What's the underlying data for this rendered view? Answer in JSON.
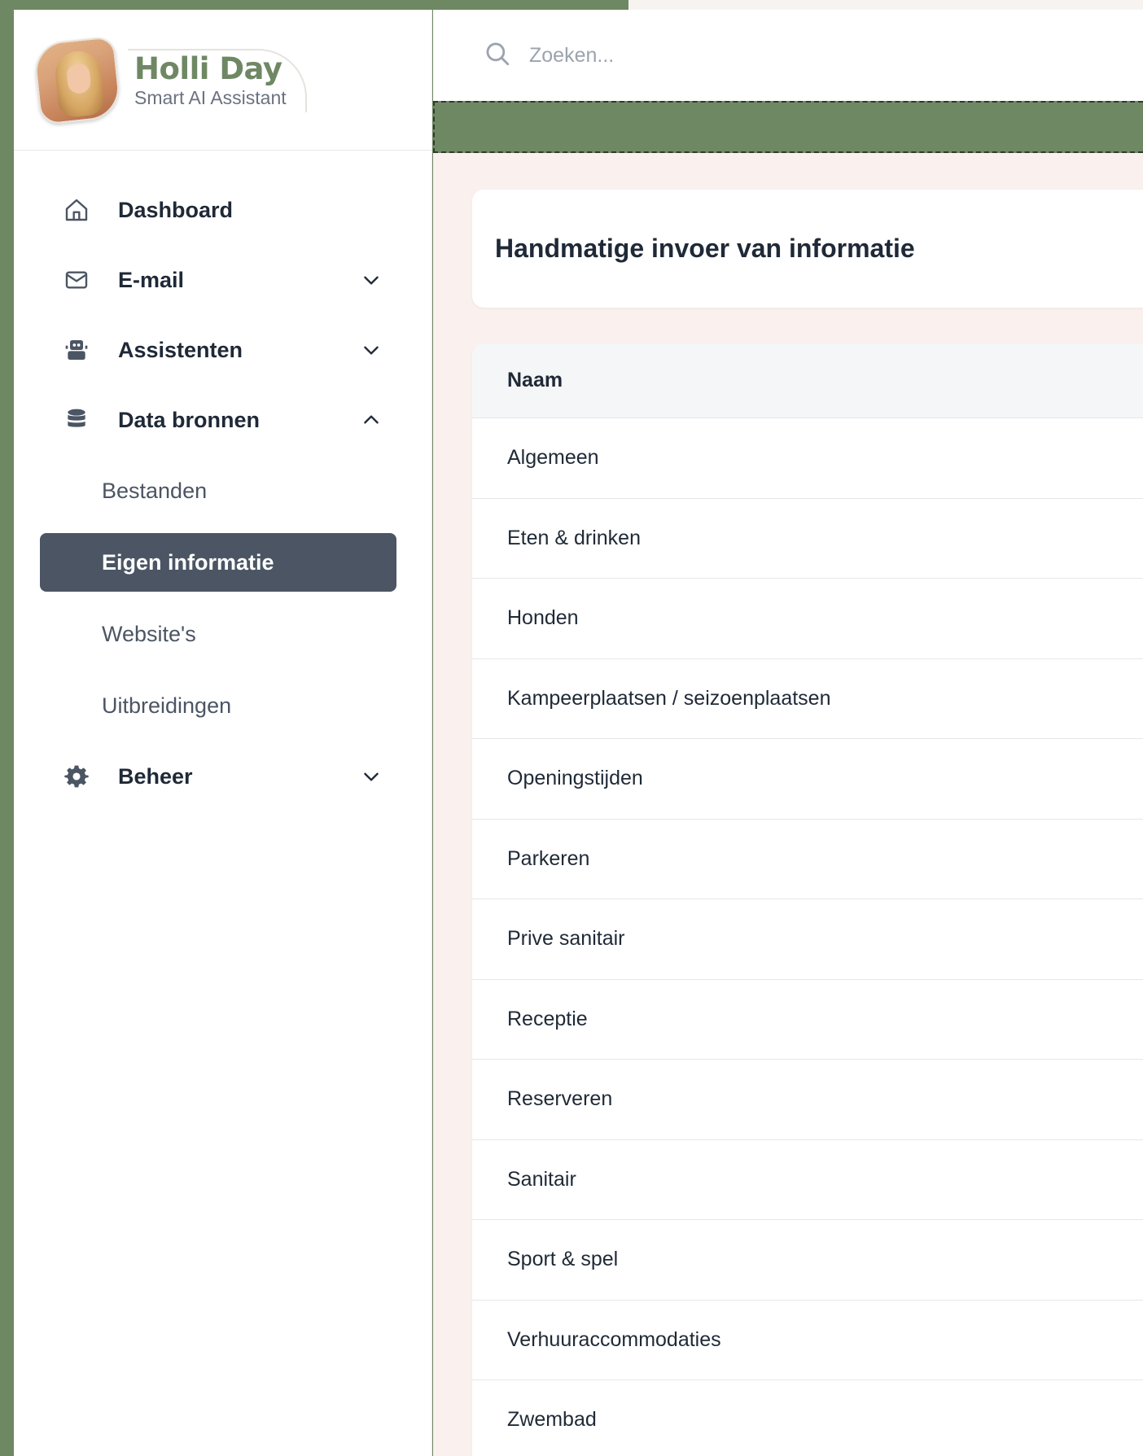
{
  "brand": {
    "name": "Holli Day",
    "subtitle": "Smart AI Assistant"
  },
  "search": {
    "placeholder": "Zoeken..."
  },
  "sidebar": {
    "items": [
      {
        "label": "Dashboard",
        "icon": "home-icon"
      },
      {
        "label": "E-mail",
        "icon": "mail-icon",
        "expanded": false
      },
      {
        "label": "Assistenten",
        "icon": "robot-icon",
        "expanded": false
      },
      {
        "label": "Data bronnen",
        "icon": "database-icon",
        "expanded": true
      },
      {
        "label": "Beheer",
        "icon": "gear-icon",
        "expanded": false
      }
    ],
    "data_sources_children": [
      {
        "label": "Bestanden",
        "active": false
      },
      {
        "label": "Eigen informatie",
        "active": true
      },
      {
        "label": "Website's",
        "active": false
      },
      {
        "label": "Uitbreidingen",
        "active": false
      }
    ]
  },
  "main": {
    "title": "Handmatige invoer van informatie",
    "table": {
      "column_header": "Naam",
      "rows": [
        "Algemeen",
        "Eten & drinken",
        "Honden",
        "Kampeerplaatsen / seizoenplaatsen",
        "Openingstijden",
        "Parkeren",
        "Prive sanitair",
        "Receptie",
        "Reserveren",
        "Sanitair",
        "Sport & spel",
        "Verhuuraccommodaties",
        "Zwembad"
      ]
    }
  },
  "colors": {
    "brand_green": "#6f8864",
    "active_nav_bg": "#4b5563",
    "main_bg": "#faf1ef"
  }
}
